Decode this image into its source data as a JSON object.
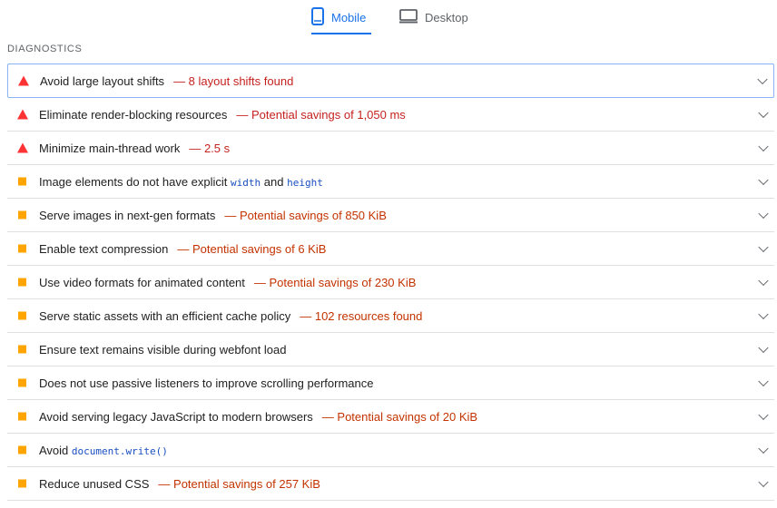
{
  "tabs": {
    "mobile": {
      "label": "Mobile",
      "icon": "phone-icon",
      "active": true
    },
    "desktop": {
      "label": "Desktop",
      "icon": "monitor-icon",
      "active": false
    }
  },
  "section": {
    "title": "DIAGNOSTICS"
  },
  "colors": {
    "accent": "#1a73e8",
    "fail": "#ff3333",
    "average": "#ffa400",
    "fail_text": "#c5221f",
    "average_text": "#c33300"
  },
  "audits": [
    {
      "severity": "fail",
      "title": "Avoid large layout shifts",
      "value": "— 8 layout shifts found"
    },
    {
      "severity": "fail",
      "title": "Eliminate render-blocking resources",
      "value": "— Potential savings of 1,050 ms"
    },
    {
      "severity": "fail",
      "title": "Minimize main-thread work",
      "value": "— 2.5 s"
    },
    {
      "severity": "average",
      "title_pre": "Image elements do not have explicit",
      "code1": "width",
      "title_mid": "and",
      "code2": "height"
    },
    {
      "severity": "average",
      "title": "Serve images in next-gen formats",
      "value": "— Potential savings of 850 KiB"
    },
    {
      "severity": "average",
      "title": "Enable text compression",
      "value": "— Potential savings of 6 KiB"
    },
    {
      "severity": "average",
      "title": "Use video formats for animated content",
      "value": "— Potential savings of 230 KiB"
    },
    {
      "severity": "average",
      "title": "Serve static assets with an efficient cache policy",
      "value": "— 102 resources found"
    },
    {
      "severity": "average",
      "title": "Ensure text remains visible during webfont load"
    },
    {
      "severity": "average",
      "title": "Does not use passive listeners to improve scrolling performance"
    },
    {
      "severity": "average",
      "title": "Avoid serving legacy JavaScript to modern browsers",
      "value": "— Potential savings of 20 KiB"
    },
    {
      "severity": "average",
      "title_pre": "Avoid",
      "code1": "document.write()"
    },
    {
      "severity": "average",
      "title": "Reduce unused CSS",
      "value": "— Potential savings of 257 KiB"
    }
  ]
}
